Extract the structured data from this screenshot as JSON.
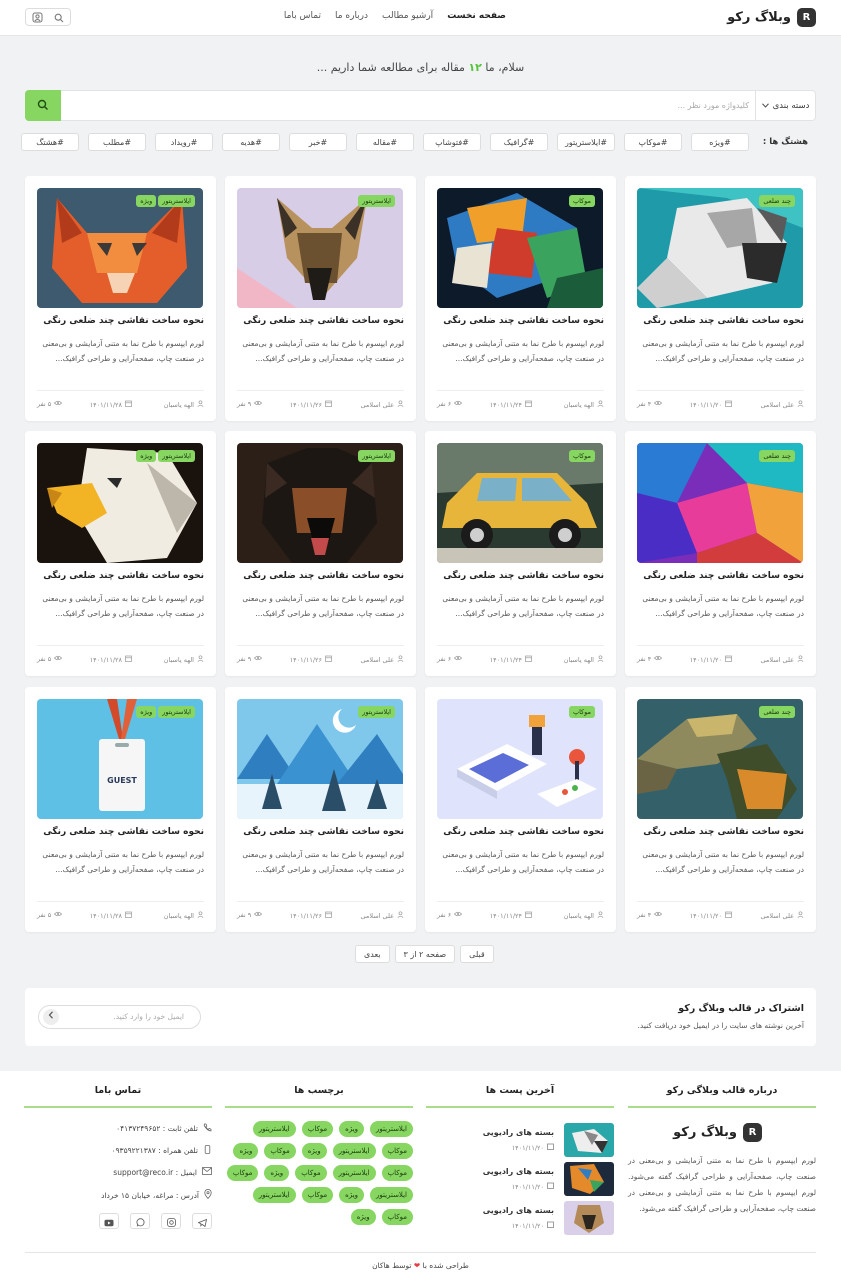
{
  "header": {
    "logo_letter": "R",
    "logo_text": "وبلاگ رکو",
    "nav": [
      "صفحه نخست",
      "آرشیو مطالب",
      "درباره ما",
      "تماس باما"
    ]
  },
  "greeting": {
    "pre": "سلام، ما",
    "count": "۱۲",
    "post": "مقاله برای مطالعه شما داریم ..."
  },
  "search": {
    "category_label": "دسته بندی",
    "placeholder": "کلیدواژه مورد نظر ..."
  },
  "hashtags": {
    "label": "هشتگ ها :",
    "items": [
      "#ویژه",
      "#موکاپ",
      "#ایلاستریتور",
      "#گرافیک",
      "#فتوشاپ",
      "#مقاله",
      "#خبر",
      "#هدیه",
      "#رویداد",
      "#مطلب",
      "#هشتگ"
    ]
  },
  "cards": [
    {
      "title": "نحوه ساخت نقاشی چند ضلعی رنگی",
      "excerpt": "لورم ایپسوم با طرح نما به متنی آزمایشی و بی‌معنی در صنعت چاپ، صفحه‌آرایی و طراحی گرافیک...",
      "badges": [
        "چند ضلعی"
      ],
      "author": "علی اسلامی",
      "date": "۱۴۰۱/۱۱/۲۰",
      "views": "۴ نفر",
      "image": "dog"
    },
    {
      "title": "نحوه ساخت نقاشی چند ضلعی رنگی",
      "excerpt": "لورم ایپسوم با طرح نما به متنی آزمایشی و بی‌معنی در صنعت چاپ، صفحه‌آرایی و طراحی گرافیک...",
      "badges": [
        "موکاپ"
      ],
      "author": "الهه یاسبان",
      "date": "۱۴۰۱/۱۱/۲۴",
      "views": "۶ نفر",
      "image": "parrot"
    },
    {
      "title": "نحوه ساخت نقاشی چند ضلعی رنگی",
      "excerpt": "لورم ایپسوم با طرح نما به متنی آزمایشی و بی‌معنی در صنعت چاپ، صفحه‌آرایی و طراحی گرافیک...",
      "badges": [
        "ایلاستریتور"
      ],
      "author": "علی اسلامی",
      "date": "۱۴۰۱/۱۱/۲۶",
      "views": "۹ نفر",
      "image": "shepherd"
    },
    {
      "title": "نحوه ساخت نقاشی چند ضلعی رنگی",
      "excerpt": "لورم ایپسوم با طرح نما به متنی آزمایشی و بی‌معنی در صنعت چاپ، صفحه‌آرایی و طراحی گرافیک...",
      "badges": [
        "ایلاستریتور",
        "ویژه"
      ],
      "author": "الهه یاسبان",
      "date": "۱۴۰۱/۱۱/۲۸",
      "views": "۵ نفر",
      "image": "cat"
    },
    {
      "title": "نحوه ساخت نقاشی چند ضلعی رنگی",
      "excerpt": "لورم ایپسوم با طرح نما به متنی آزمایشی و بی‌معنی در صنعت چاپ، صفحه‌آرایی و طراحی گرافیک...",
      "badges": [
        "چند ضلعی"
      ],
      "author": "علی اسلامی",
      "date": "۱۴۰۱/۱۱/۲۰",
      "views": "۴ نفر",
      "image": "abstract"
    },
    {
      "title": "نحوه ساخت نقاشی چند ضلعی رنگی",
      "excerpt": "لورم ایپسوم با طرح نما به متنی آزمایشی و بی‌معنی در صنعت چاپ، صفحه‌آرایی و طراحی گرافیک...",
      "badges": [
        "موکاپ"
      ],
      "author": "الهه یاسبان",
      "date": "۱۴۰۱/۱۱/۲۴",
      "views": "۶ نفر",
      "image": "car"
    },
    {
      "title": "نحوه ساخت نقاشی چند ضلعی رنگی",
      "excerpt": "لورم ایپسوم با طرح نما به متنی آزمایشی و بی‌معنی در صنعت چاپ، صفحه‌آرایی و طراحی گرافیک...",
      "badges": [
        "ایلاستریتور"
      ],
      "author": "علی اسلامی",
      "date": "۱۴۰۱/۱۱/۲۶",
      "views": "۹ نفر",
      "image": "rottweiler"
    },
    {
      "title": "نحوه ساخت نقاشی چند ضلعی رنگی",
      "excerpt": "لورم ایپسوم با طرح نما به متنی آزمایشی و بی‌معنی در صنعت چاپ، صفحه‌آرایی و طراحی گرافیک...",
      "badges": [
        "ایلاستریتور",
        "ویژه"
      ],
      "author": "الهه یاسبان",
      "date": "۱۴۰۱/۱۱/۲۸",
      "views": "۵ نفر",
      "image": "eagle"
    },
    {
      "title": "نحوه ساخت نقاشی چند ضلعی رنگی",
      "excerpt": "لورم ایپسوم با طرح نما به متنی آزمایشی و بی‌معنی در صنعت چاپ، صفحه‌آرایی و طراحی گرافیک...",
      "badges": [
        "چند ضلعی"
      ],
      "author": "علی اسلامی",
      "date": "۱۴۰۱/۱۱/۲۰",
      "views": "۴ نفر",
      "image": "iguana"
    },
    {
      "title": "نحوه ساخت نقاشی چند ضلعی رنگی",
      "excerpt": "لورم ایپسوم با طرح نما به متنی آزمایشی و بی‌معنی در صنعت چاپ، صفحه‌آرایی و طراحی گرافیک...",
      "badges": [
        "موکاپ"
      ],
      "author": "الهه یاسبان",
      "date": "۱۴۰۱/۱۱/۲۴",
      "views": "۶ نفر",
      "image": "gaming"
    },
    {
      "title": "نحوه ساخت نقاشی چند ضلعی رنگی",
      "excerpt": "لورم ایپسوم با طرح نما به متنی آزمایشی و بی‌معنی در صنعت چاپ، صفحه‌آرایی و طراحی گرافیک...",
      "badges": [
        "ایلاستریتور"
      ],
      "author": "علی اسلامی",
      "date": "۱۴۰۱/۱۱/۲۶",
      "views": "۹ نفر",
      "image": "winter"
    },
    {
      "title": "نحوه ساخت نقاشی چند ضلعی رنگی",
      "excerpt": "لورم ایپسوم با طرح نما به متنی آزمایشی و بی‌معنی در صنعت چاپ، صفحه‌آرایی و طراحی گرافیک...",
      "badges": [
        "ایلاستریتور",
        "ویژه"
      ],
      "author": "الهه یاسبان",
      "date": "۱۴۰۱/۱۱/۲۸",
      "views": "۵ نفر",
      "image": "badge"
    }
  ],
  "pagination": {
    "prev": "قبلی",
    "status": "صفحه ۲ از ۳",
    "next": "بعدی"
  },
  "subscribe": {
    "title": "اشتراک در قالب وبلاگ رکو",
    "desc": "آخرین نوشته های سایت را در ایمیل خود دریافت کنید.",
    "placeholder": "ایمیل خود را وارد کنید."
  },
  "footer": {
    "about": {
      "heading": "درباره قالب وبلاگی رکو",
      "logo_letter": "R",
      "logo_text": "وبلاگ رکو",
      "text": "لورم ایپسوم با طرح نما به متنی آزمایشی و بی‌معنی در صنعت چاپ، صفحه‌آرایی و طراحی گرافیک گفته می‌شود. لورم ایپسوم با طرح نما به متنی آزمایشی و بی‌معنی در صنعت چاپ، صفحه‌آرایی و طراحی گرافیک گفته می‌شود."
    },
    "latest": {
      "heading": "آخرین پست ها",
      "posts": [
        {
          "title": "بسته های رادیویی",
          "date": "۱۴۰۱/۱۱/۲۰"
        },
        {
          "title": "بسته های رادیویی",
          "date": "۱۴۰۱/۱۱/۲۰"
        },
        {
          "title": "بسته های رادیویی",
          "date": "۱۴۰۱/۱۱/۲۰"
        }
      ]
    },
    "tags": {
      "heading": "برچسب ها",
      "items": [
        "ایلاستریتور",
        "ویژه",
        "موکاپ",
        "ایلاستریتور",
        "موکاپ",
        "ایلاستریتور",
        "ویژه",
        "موکاپ",
        "ویژه",
        "موکاپ",
        "ایلاستریتور",
        "موکاپ",
        "ویژه",
        "موکاپ",
        "ایلاستریتور",
        "ویژه",
        "موکاپ",
        "ایلاستریتور",
        "موکاپ",
        "ویژه"
      ]
    },
    "contact": {
      "heading": "تماس باما",
      "phone": "تلفن ثابت : ۰۴۱۳۷۲۴۹۶۵۲",
      "mobile": "تلفن همراه : ۰۹۳۵۹۲۲۱۳۸۷",
      "email": "ایمیل : support@reco.ir",
      "address": "آدرس : مراغه، خیابان ۱۵ خرداد"
    },
    "copyright": {
      "pre": "طراحی شده با",
      "post": "توسط هاکان"
    }
  },
  "colors": {
    "accent": "#86d661",
    "accent_text": "#55c43c",
    "heart": "#e83c3c"
  }
}
